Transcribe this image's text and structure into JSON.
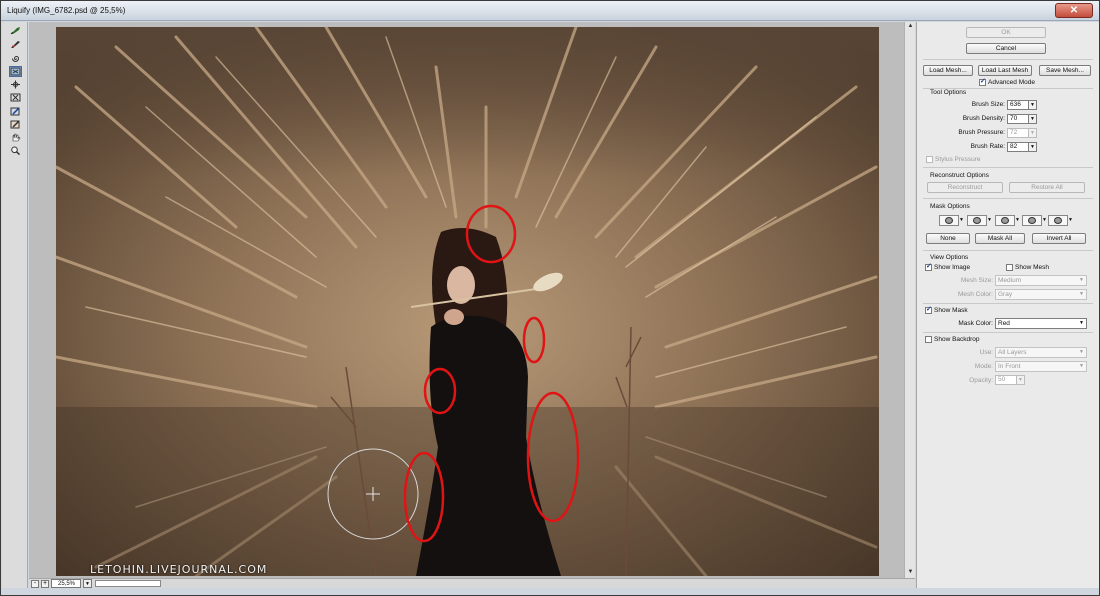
{
  "window": {
    "title": "Liquify (IMG_6782.psd @ 25,5%)",
    "close_label": "✕"
  },
  "toolbar": {
    "tools": [
      {
        "name": "forward-warp-tool-icon"
      },
      {
        "name": "reconstruct-tool-icon"
      },
      {
        "name": "twirl-tool-icon"
      },
      {
        "name": "pucker-tool-icon"
      },
      {
        "name": "bloat-tool-icon"
      },
      {
        "name": "push-left-tool-icon"
      },
      {
        "name": "freeze-mask-tool-icon"
      },
      {
        "name": "thaw-mask-tool-icon"
      },
      {
        "name": "hand-tool-icon"
      },
      {
        "name": "zoom-tool-icon"
      }
    ],
    "active_index": 3
  },
  "canvas": {
    "watermark": "LETOHIN.LIVEJOURNAL.COM"
  },
  "status": {
    "zoom_minus": "-",
    "zoom_plus": "+",
    "zoom_value": "25,5%",
    "zoom_drop": "▼"
  },
  "panel": {
    "ok_label": "OK",
    "cancel_label": "Cancel",
    "load_mesh_label": "Load Mesh...",
    "load_last_mesh_label": "Load Last Mesh",
    "save_mesh_label": "Save Mesh...",
    "advanced_mode_label": "Advanced Mode",
    "tool_options_title": "Tool Options",
    "brush_size_label": "Brush Size:",
    "brush_size_value": "636",
    "brush_density_label": "Brush Density:",
    "brush_density_value": "70",
    "brush_pressure_label": "Brush Pressure:",
    "brush_pressure_value": "72",
    "brush_rate_label": "Brush Rate:",
    "brush_rate_value": "82",
    "stylus_pressure_label": "Stylus Pressure",
    "reconstruct_options_title": "Reconstruct Options",
    "reconstruct_label": "Reconstruct",
    "restore_all_label": "Restore All",
    "mask_options_title": "Mask Options",
    "none_label": "None",
    "mask_all_label": "Mask All",
    "invert_all_label": "Invert All",
    "view_options_title": "View Options",
    "show_image_label": "Show Image",
    "show_mesh_label": "Show Mesh",
    "mesh_size_label": "Mesh Size:",
    "mesh_size_value": "Medium",
    "mesh_color_label": "Mesh Color:",
    "mesh_color_value": "Gray",
    "show_mask_label": "Show Mask",
    "mask_color_label": "Mask Color:",
    "mask_color_value": "Red",
    "show_backdrop_label": "Show Backdrop",
    "use_label": "Use:",
    "use_value": "All Layers",
    "mode_label": "Mode:",
    "mode_value": "In Front",
    "opacity_label": "Opacity:",
    "opacity_value": "50",
    "drop_arrow": "▼"
  },
  "colors": {
    "annotation_red": "#e01414",
    "active_tool": "#9fb8d8"
  }
}
